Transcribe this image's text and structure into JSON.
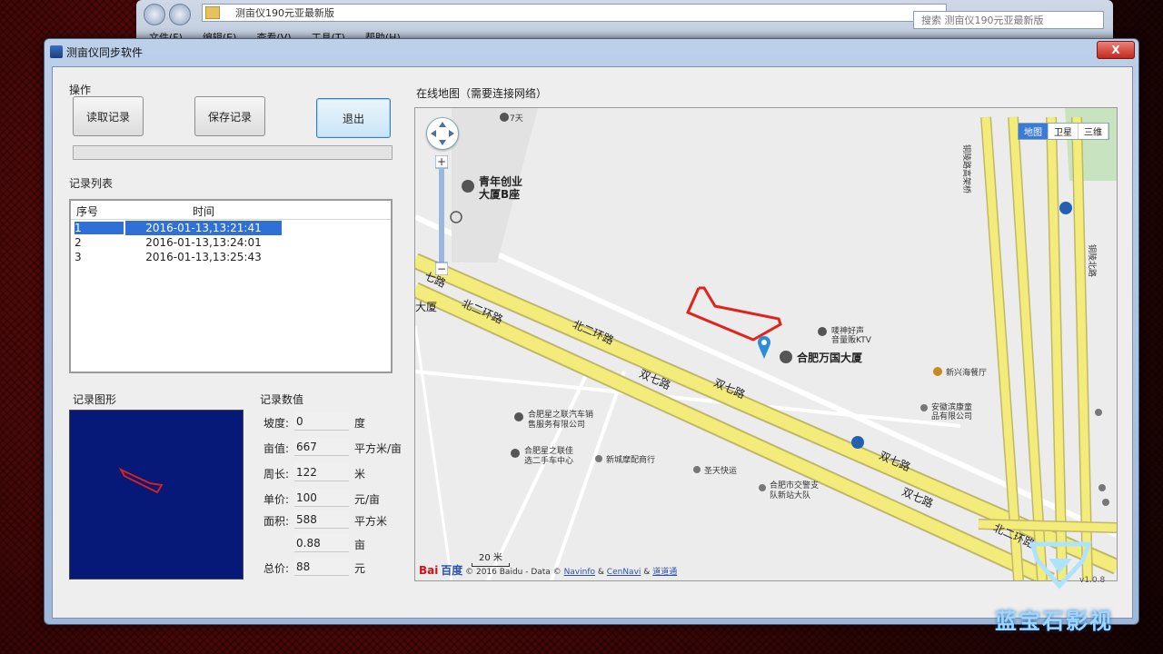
{
  "explorer": {
    "address": "测亩仪190元亚最新版",
    "search_placeholder": "搜索 测亩仪190元亚最新版",
    "menu": [
      "文件(F)",
      "编辑(E)",
      "查看(V)",
      "工具(T)",
      "帮助(H)"
    ]
  },
  "window": {
    "title": "测亩仪同步软件",
    "close_symbol": "X"
  },
  "operations": {
    "group_label": "操作",
    "read_button": "读取记录",
    "save_button": "保存记录",
    "exit_button": "退出",
    "progress": 0
  },
  "records": {
    "group_label": "记录列表",
    "columns": [
      "序号",
      "时间"
    ],
    "rows": [
      {
        "id": "1",
        "time": "2016-01-13,13:21:41",
        "selected": true
      },
      {
        "id": "2",
        "time": "2016-01-13,13:24:01",
        "selected": false
      },
      {
        "id": "3",
        "time": "2016-01-13,13:25:43",
        "selected": false
      }
    ]
  },
  "graphic": {
    "group_label": "记录图形",
    "background": "#061878",
    "stroke": "#d8201a"
  },
  "values": {
    "group_label": "记录数值",
    "slope_label": "坡度:",
    "slope": "0",
    "slope_unit": "度",
    "per_mu_label": "亩值:",
    "per_mu": "667",
    "per_mu_unit": "平方米/亩",
    "perimeter_label": "周长:",
    "perimeter": "122",
    "perimeter_unit": "米",
    "price_label": "单价:",
    "price": "100",
    "price_unit": "元/亩",
    "area_label": "面积:",
    "area": "588",
    "area_unit": "平方米",
    "area_mu": "0.88",
    "area_mu_unit": "亩",
    "total_label": "总价:",
    "total": "88",
    "total_unit": "元"
  },
  "map": {
    "group_label": "在线地图（需要连接网络）",
    "map_types": [
      "地图",
      "卫星",
      "三维"
    ],
    "labels": {
      "seven_days": "7天",
      "youth": "青年创业",
      "youth2": "大厦B座",
      "road_north2_a": "北二环路",
      "road_north2_b": "北二环路",
      "road_shuangqi_a": "双七路",
      "road_shuangqi_b": "双七路",
      "road_shuangqi_c": "双七路",
      "road_north2_c": "北二环路",
      "road_qi": "七路",
      "dasha": "大厦",
      "ktv": "唛神好声",
      "ktv2": "音量贩KTV",
      "wanguo": "合肥万国大厦",
      "restaurant": "新兴海餐厅",
      "anhui1": "安徽滨康童",
      "anhui2": "品有限公司",
      "car1": "合肥星之联汽车销",
      "car2": "售服务有限公司",
      "car3": "合肥星之联佳",
      "car4": "选二手车中心",
      "parts": "新城摩配商行",
      "express": "圣天快运",
      "police1": "合肥市交警支",
      "police2": "队新站大队",
      "bridge1": "铜陵路高架桥",
      "bridge2": "铜陵北路"
    },
    "scale": "20 米",
    "copyright_logo": "Bai",
    "copyright_logo2": "百度",
    "copyright_text": "© 2016 Baidu - Data ©",
    "copyright_link1": "Navinfo",
    "copyright_amp": "&",
    "copyright_link2": "CenNavi",
    "copyright_amp2": "&",
    "copyright_link3": "道道通",
    "track_color": "#e0231b"
  },
  "version": "v1.0.8",
  "watermark": "蓝宝石影视"
}
